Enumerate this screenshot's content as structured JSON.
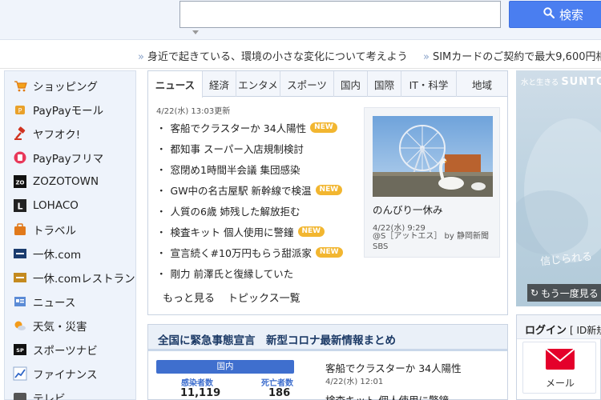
{
  "search": {
    "value": "",
    "button_label": "検索"
  },
  "promo": [
    "身近で起きている、環境の小さな変化について考えよう",
    "SIMカードのご契約で最大9,600円相"
  ],
  "sidebar": {
    "items": [
      {
        "label": "ショッピング",
        "icon": "shopping-cart-icon"
      },
      {
        "label": "PayPayモール",
        "icon": "paypay-mall-icon"
      },
      {
        "label": "ヤフオク!",
        "icon": "auction-gavel-icon"
      },
      {
        "label": "PayPayフリマ",
        "icon": "flea-market-icon"
      },
      {
        "label": "ZOZOTOWN",
        "icon": "zozotown-icon"
      },
      {
        "label": "LOHACO",
        "icon": "lohaco-icon"
      },
      {
        "label": "トラベル",
        "icon": "suitcase-icon"
      },
      {
        "label": "一休.com",
        "icon": "ikyu-icon"
      },
      {
        "label": "一休.comレストラン",
        "icon": "ikyu-restaurant-icon"
      },
      {
        "label": "ニュース",
        "icon": "news-icon"
      },
      {
        "label": "天気・災害",
        "icon": "weather-icon"
      },
      {
        "label": "スポーツナビ",
        "icon": "sportsnavi-icon"
      },
      {
        "label": "ファイナンス",
        "icon": "finance-chart-icon"
      },
      {
        "label": "テレビ",
        "icon": "tv-icon"
      }
    ]
  },
  "news": {
    "tabs": [
      "ニュース",
      "経済",
      "エンタメ",
      "スポーツ",
      "国内",
      "国際",
      "IT・科学",
      "地域"
    ],
    "updated": "4/22(水) 13:03更新",
    "headlines": [
      {
        "text": "客船でクラスターか 34人陽性",
        "new": true
      },
      {
        "text": "都知事 スーパー入店規制検討",
        "new": false
      },
      {
        "text": "窓閉め1時間半会議 集団感染",
        "new": false
      },
      {
        "text": "GW中の名古屋駅 新幹線で検温",
        "new": true
      },
      {
        "text": "人質の6歳 姉残した解放拒む",
        "new": false
      },
      {
        "text": "検査キット 個人使用に警鐘",
        "new": true
      },
      {
        "text": "宣言続く#10万円もらう甜派家",
        "new": true
      },
      {
        "text": "剛力 前澤氏と復縁していた",
        "new": false
      }
    ],
    "new_label": "NEW",
    "more_link": "もっと見る",
    "topics_link": "トピックス一覧",
    "photo": {
      "title": "のんびり一休み",
      "date": "4/22(水) 9:29",
      "source": "@S［アットエス］ by 静岡新聞SBS"
    }
  },
  "covid": {
    "title": "全国に緊急事態宣言　新型コロナ最新情報まとめ",
    "domestic_label": "国内",
    "infected_label": "感染者数",
    "infected_value": "11,119",
    "deaths_label": "死亡者数",
    "deaths_value": "186",
    "news": [
      {
        "text": "客船でクラスターか 34人陽性",
        "date": "4/22(水) 12:01"
      },
      {
        "text": "検査キット 個人使用に警鐘",
        "date": ""
      }
    ]
  },
  "ad": {
    "tagline": "水と生きる",
    "brand": "SUNTO",
    "script": "信じられる",
    "replay_label": "もう一度見る"
  },
  "login": {
    "title": "ログイン",
    "id_text": "[ ID新規",
    "mail_label": "メール"
  },
  "colors": {
    "accent": "#4a7ef0",
    "new_badge": "#f2b630",
    "covid_blue": "#3f6fce",
    "mail_red": "#e4002b"
  }
}
